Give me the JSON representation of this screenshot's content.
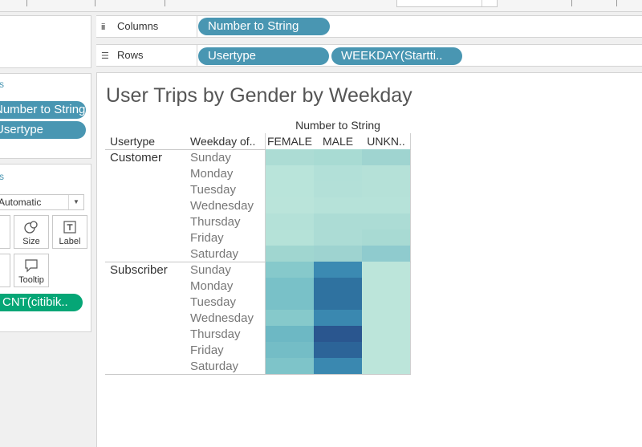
{
  "shelves": {
    "columns": {
      "label": "Columns",
      "pills": [
        "Number to String"
      ]
    },
    "rows": {
      "label": "Rows",
      "pills": [
        "Usertype",
        "WEEKDAY(Startti.."
      ]
    }
  },
  "filters_panel": {
    "pills": [
      "Number to String",
      "Usertype"
    ]
  },
  "marks_panel": {
    "mark_type": "Automatic",
    "buttons": {
      "size": "Size",
      "label": "Label",
      "tooltip": "Tooltip"
    },
    "pills": [
      "CNT(citibik.."
    ]
  },
  "view": {
    "title": "User Trips by Gender by Weekday",
    "column_group": "Number to String",
    "headers": {
      "usertype": "Usertype",
      "weekday": "Weekday of..",
      "columns": [
        "FEMALE",
        "MALE",
        "UNKN.."
      ]
    },
    "groups": [
      {
        "label": "Customer",
        "weekdays": [
          "Sunday",
          "Monday",
          "Tuesday",
          "Wednesday",
          "Thursday",
          "Friday",
          "Saturday"
        ]
      },
      {
        "label": "Subscriber",
        "weekdays": [
          "Sunday",
          "Monday",
          "Tuesday",
          "Wednesday",
          "Thursday",
          "Friday",
          "Saturday"
        ]
      }
    ]
  },
  "chart_data": {
    "type": "heatmap",
    "title": "User Trips by Gender by Weekday",
    "columns": [
      "FEMALE",
      "MALE",
      "UNKN.."
    ],
    "row_groups": [
      "Customer",
      "Subscriber"
    ],
    "rows": [
      "Sunday",
      "Monday",
      "Tuesday",
      "Wednesday",
      "Thursday",
      "Friday",
      "Saturday"
    ],
    "colors": [
      [
        "#acdcd4",
        "#a8dbd3",
        "#9fd4d0"
      ],
      [
        "#b9e4da",
        "#b2e0d8",
        "#b5e1d8"
      ],
      [
        "#b9e4da",
        "#b3e0d8",
        "#b5e1d8"
      ],
      [
        "#bae4da",
        "#b6e2d9",
        "#b6e2d9"
      ],
      [
        "#b4e1d8",
        "#acdcd5",
        "#acdcd5"
      ],
      [
        "#b5e2d8",
        "#acdcd5",
        "#a8dad3"
      ],
      [
        "#a0d6d0",
        "#9ed3d0",
        "#8fcbce"
      ],
      [
        "#86c9cb",
        "#3b8ab2",
        "#bce5da"
      ],
      [
        "#79c1c8",
        "#2f72a0",
        "#bce5da"
      ],
      [
        "#79c1c8",
        "#2f72a0",
        "#bce5da"
      ],
      [
        "#86c9cb",
        "#3a88b0",
        "#bce5da"
      ],
      [
        "#6db8c4",
        "#2a568f",
        "#bce5da"
      ],
      [
        "#74bdc6",
        "#2c6498",
        "#bce5da"
      ],
      [
        "#7ec4c9",
        "#3a88b0",
        "#bce5da"
      ]
    ]
  }
}
